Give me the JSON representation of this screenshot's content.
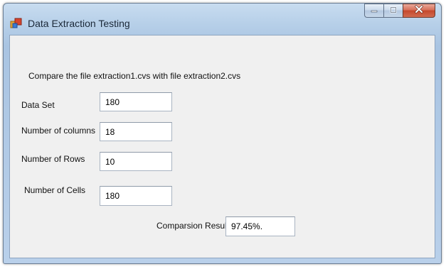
{
  "window": {
    "title": "Data Extraction Testing"
  },
  "caption_buttons": {
    "minimize": "minimize-icon",
    "maximize": "maximize-icon",
    "close": "close-icon"
  },
  "form": {
    "description": "Compare the file extraction1.cvs with file extraction2.cvs",
    "data_set_label": "Data Set",
    "data_set_value": "180",
    "columns_label": "Number of columns",
    "columns_value": "18",
    "rows_label": "Number of Rows",
    "rows_value": "10",
    "cells_label": "Number of Cells",
    "cells_value": "180",
    "result_label": "Comparsion Result",
    "result_value": "97.45%."
  },
  "colors": {
    "title_bar": "#b6cfe8",
    "client_background": "#f0f0f0",
    "close_button": "#c5482c"
  }
}
